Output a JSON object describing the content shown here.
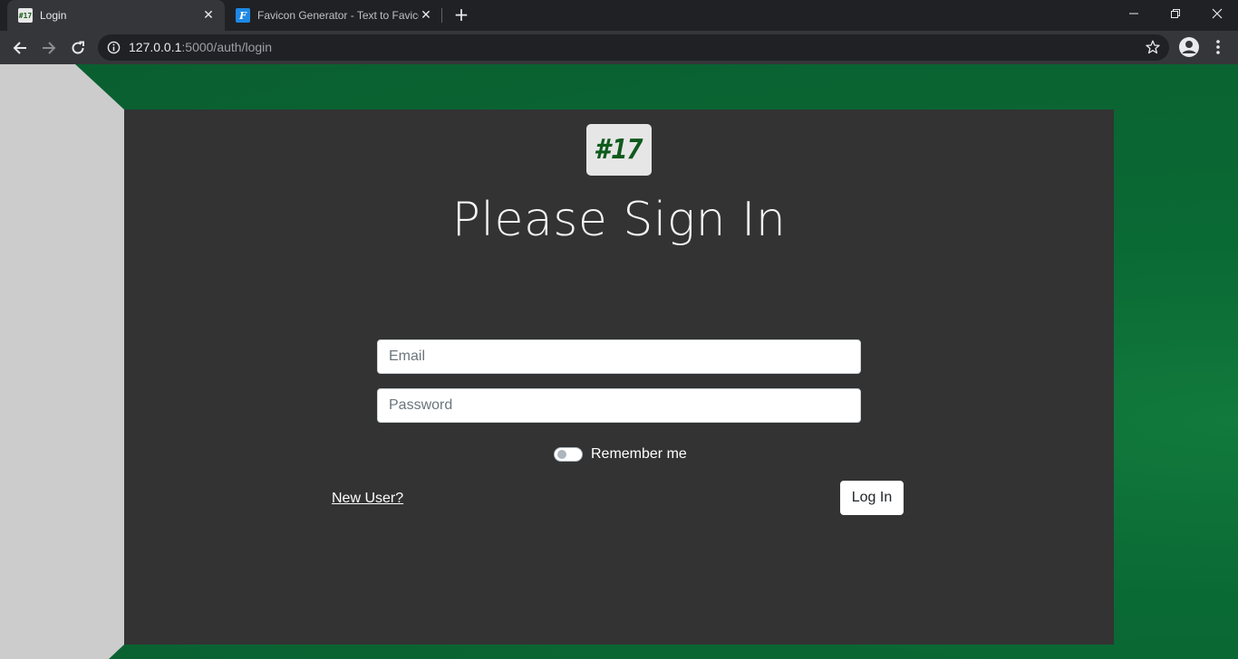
{
  "browser": {
    "tabs": [
      {
        "title": "Login",
        "favicon": "#17",
        "active": true
      },
      {
        "title": "Favicon Generator - Text to Favicon",
        "favicon": "F",
        "active": false
      }
    ],
    "new_tab_icon": "plus-icon",
    "address": {
      "host": "127.0.0.1",
      "path": ":5000/auth/login"
    }
  },
  "page": {
    "logo_text": "#17",
    "title": "Please Sign In",
    "form": {
      "email_placeholder": "Email",
      "password_placeholder": "Password",
      "remember_label": "Remember me",
      "remember_checked": false,
      "new_user_link": "New User?",
      "submit_label": "Log In"
    }
  },
  "colors": {
    "background_green": "#0a6a34",
    "card": "#333333",
    "side_panel": "#cccccc",
    "logo_text": "#0f5a1d"
  }
}
